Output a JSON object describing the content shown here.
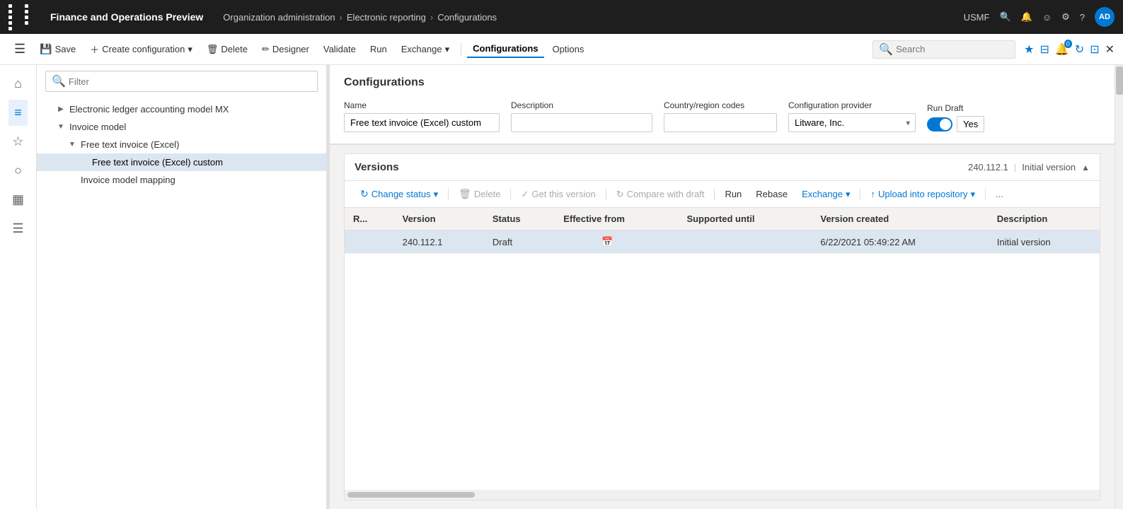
{
  "app": {
    "title": "Finance and Operations Preview",
    "breadcrumb": [
      "Organization administration",
      "Electronic reporting",
      "Configurations"
    ],
    "env": "USMF",
    "avatar": "AD"
  },
  "toolbar": {
    "save": "Save",
    "create_configuration": "Create configuration",
    "delete": "Delete",
    "designer": "Designer",
    "validate": "Validate",
    "run": "Run",
    "exchange": "Exchange",
    "configurations_tab": "Configurations",
    "options_tab": "Options"
  },
  "sidebar_narrow": {
    "icons": [
      "⊞",
      "☆",
      "○",
      "▦",
      "☰"
    ]
  },
  "tree": {
    "filter_placeholder": "Filter",
    "items": [
      {
        "label": "Electronic ledger accounting model MX",
        "indent": 1,
        "expandable": true,
        "expanded": false
      },
      {
        "label": "Invoice model",
        "indent": 1,
        "expandable": true,
        "expanded": true
      },
      {
        "label": "Free text invoice (Excel)",
        "indent": 2,
        "expandable": true,
        "expanded": true
      },
      {
        "label": "Free text invoice (Excel) custom",
        "indent": 3,
        "expandable": false,
        "selected": true
      },
      {
        "label": "Invoice model mapping",
        "indent": 2,
        "expandable": false,
        "expanded": false
      }
    ]
  },
  "configurations": {
    "section_title": "Configurations",
    "name_label": "Name",
    "name_value": "Free text invoice (Excel) custom",
    "description_label": "Description",
    "description_value": "",
    "country_label": "Country/region codes",
    "country_value": "",
    "provider_label": "Configuration provider",
    "provider_value": "Litware, Inc.",
    "run_draft_label": "Run Draft",
    "run_draft_value": "Yes"
  },
  "versions": {
    "title": "Versions",
    "version_number": "240.112.1",
    "version_label": "Initial version",
    "toolbar": {
      "change_status": "Change status",
      "delete": "Delete",
      "get_this_version": "Get this version",
      "compare_with_draft": "Compare with draft",
      "run": "Run",
      "rebase": "Rebase",
      "exchange": "Exchange",
      "upload_into_repository": "Upload into repository",
      "more": "..."
    },
    "table": {
      "columns": [
        "R...",
        "Version",
        "Status",
        "Effective from",
        "Supported until",
        "Version created",
        "Description"
      ],
      "rows": [
        {
          "r": "",
          "version": "240.112.1",
          "status": "Draft",
          "effective_from": "",
          "supported_until": "",
          "version_created": "6/22/2021 05:49:22 AM",
          "description": "Initial version",
          "selected": true
        }
      ]
    }
  }
}
